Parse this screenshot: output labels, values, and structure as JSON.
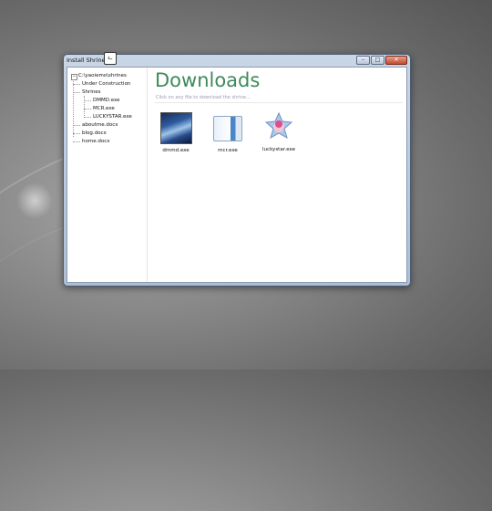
{
  "window": {
    "title": "Install Shrine?",
    "minimize": "–",
    "maximize": "□",
    "close": "✕"
  },
  "tree": {
    "root": "C:\\yaoiemo\\shrines",
    "items": [
      {
        "label": "Under Construction"
      },
      {
        "label": "Shrines"
      },
      {
        "label": "DMMD.exe"
      },
      {
        "label": "MCR.exe"
      },
      {
        "label": "LUCKYSTAR.exe"
      },
      {
        "label": "aboutme.docx"
      },
      {
        "label": "blog.docx"
      },
      {
        "label": "home.docx"
      }
    ]
  },
  "main": {
    "heading": "Downloads",
    "hint": "Click on any file to download the shrine..."
  },
  "files": [
    {
      "label": "dmmd.exe"
    },
    {
      "label": "mcr.exe"
    },
    {
      "label": "luckystar.exe"
    }
  ],
  "colors": {
    "heading": "#3f8a5a",
    "hint": "#9a9ab2"
  }
}
